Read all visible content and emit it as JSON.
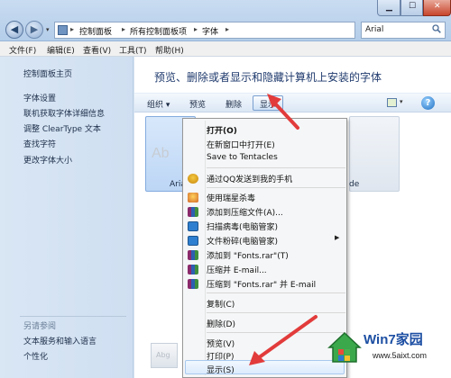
{
  "window": {
    "address": {
      "crumbs": [
        "控制面板",
        "所有控制面板项",
        "字体"
      ]
    },
    "search_value": "Arial"
  },
  "menubar": [
    {
      "label": "文件(F)"
    },
    {
      "label": "编辑(E)"
    },
    {
      "label": "查看(V)"
    },
    {
      "label": "工具(T)"
    },
    {
      "label": "帮助(H)"
    }
  ],
  "sidebar": {
    "home": "控制面板主页",
    "links": [
      "字体设置",
      "联机获取字体详细信息",
      "调整 ClearType 文本",
      "查找字符",
      "更改字体大小"
    ],
    "see_also_title": "另请参阅",
    "see_also": [
      "文本服务和输入语言",
      "个性化"
    ]
  },
  "main": {
    "title": "预览、删除或者显示和隐藏计算机上安装的字体",
    "toolbar": {
      "organize": "组织 ▾",
      "preview": "预览",
      "delete": "删除",
      "show": "显示"
    },
    "tiles": [
      {
        "glyph": "Ab",
        "label": "Arial",
        "selected": true
      },
      {
        "glyph": "",
        "label": "de",
        "selected": false
      }
    ],
    "bottom_tile_glyph": "Abg"
  },
  "context_menu": {
    "items": [
      {
        "label": "打开(O)",
        "bold": true
      },
      {
        "label": "在新窗口中打开(E)"
      },
      {
        "label": "Save to Tentacles"
      },
      {
        "label": "通过QQ发送到我的手机",
        "icon": "qq-icon"
      },
      {
        "label": "使用瑞星杀毒",
        "icon": "rising-antivirus-icon"
      },
      {
        "label": "添加到压缩文件(A)...",
        "icon": "winrar-icon"
      },
      {
        "label": "扫描病毒(电脑管家)",
        "icon": "pc-manager-icon"
      },
      {
        "label": "文件粉碎(电脑管家)",
        "icon": "pc-manager-icon",
        "submenu": true
      },
      {
        "label": "添加到 \"Fonts.rar\"(T)",
        "icon": "winrar-icon"
      },
      {
        "label": "压缩并 E-mail...",
        "icon": "winrar-icon"
      },
      {
        "label": "压缩到 \"Fonts.rar\" 并 E-mail",
        "icon": "winrar-icon"
      },
      {
        "label": "复制(C)"
      },
      {
        "label": "删除(D)"
      },
      {
        "label": "预览(V)"
      },
      {
        "label": "打印(P)"
      },
      {
        "label": "显示(S)",
        "highlighted": true
      }
    ]
  },
  "watermark": {
    "title": "Win7家园",
    "url": "www.5aixt.com"
  },
  "colors": {
    "annotation_red": "#e23b3b",
    "menu_highlight": "#dcebfc",
    "title_blue": "#1f3a6d"
  }
}
